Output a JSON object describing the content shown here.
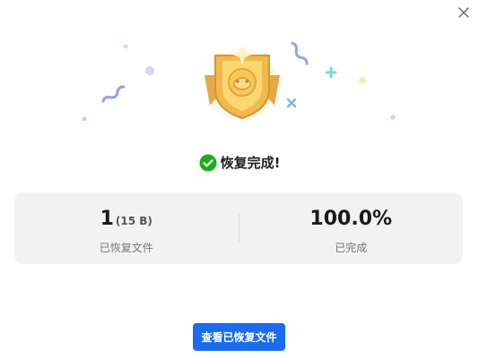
{
  "dialog": {
    "close_icon": "close-icon",
    "status_icon": "check-circle-icon",
    "status_text": "恢复完成!",
    "status_color": "#1aad19",
    "accent_color": "#1a6cf0"
  },
  "stats": {
    "files_count": "1",
    "files_size": "(15 B)",
    "files_label": "已恢复文件",
    "progress_value": "100.0%",
    "progress_label": "已完成"
  },
  "actions": {
    "view_button_label": "查看已恢复文件"
  }
}
